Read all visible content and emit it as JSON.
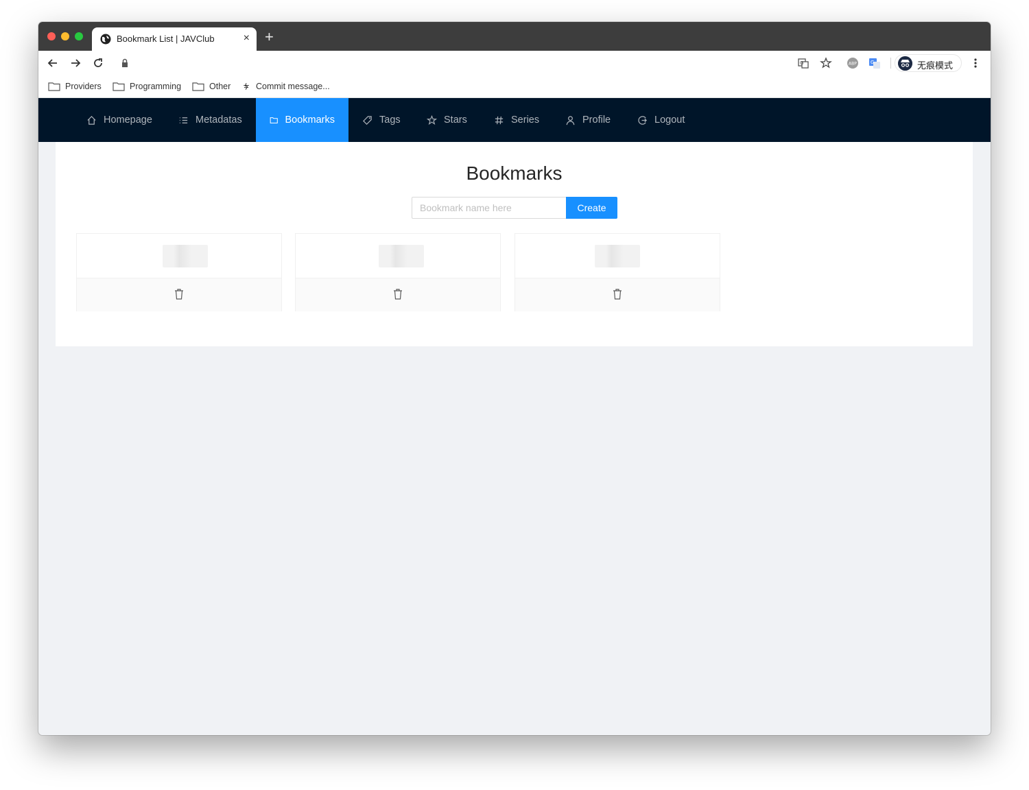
{
  "browser": {
    "tab_title": "Bookmark List | JAVClub",
    "tab_close": "×",
    "new_tab": "+",
    "profile_label": "无痕模式",
    "bookmarks_bar": [
      "Providers",
      "Programming",
      "Other",
      "Commit message..."
    ]
  },
  "nav": {
    "items": [
      {
        "label": "Homepage",
        "icon": "home-icon",
        "active": false
      },
      {
        "label": "Metadatas",
        "icon": "list-icon",
        "active": false
      },
      {
        "label": "Bookmarks",
        "icon": "folder-icon",
        "active": true
      },
      {
        "label": "Tags",
        "icon": "tag-icon",
        "active": false
      },
      {
        "label": "Stars",
        "icon": "star-icon",
        "active": false
      },
      {
        "label": "Series",
        "icon": "hash-icon",
        "active": false
      },
      {
        "label": "Profile",
        "icon": "user-icon",
        "active": false
      },
      {
        "label": "Logout",
        "icon": "logout-icon",
        "active": false
      }
    ]
  },
  "page": {
    "title": "Bookmarks",
    "input_placeholder": "Bookmark name here",
    "create_label": "Create"
  },
  "cards_count": 3,
  "colors": {
    "nav_bg": "#001529",
    "accent": "#1890ff",
    "page_bg": "#f0f2f5"
  }
}
